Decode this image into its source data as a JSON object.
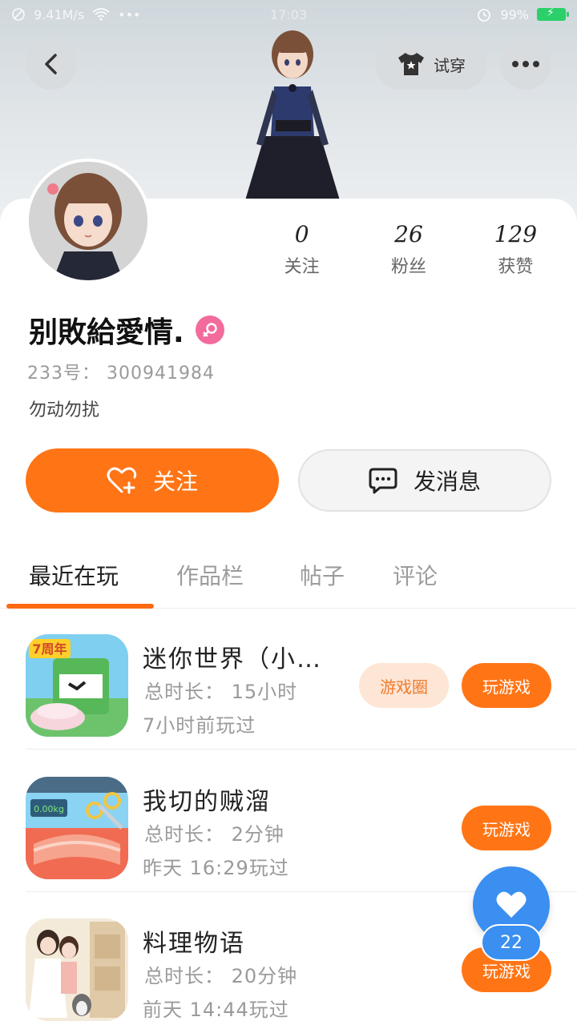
{
  "status_bar": {
    "network_speed": "9.41M/s",
    "time": "17:03",
    "battery": "99%"
  },
  "header": {
    "try_on_label": "试穿"
  },
  "profile": {
    "stats": [
      {
        "value": "0",
        "label": "关注"
      },
      {
        "value": "26",
        "label": "粉丝"
      },
      {
        "value": "129",
        "label": "获赞"
      }
    ],
    "name": "别敗給愛情.",
    "uid": "233号： 300941984",
    "bio": "勿动勿扰",
    "follow_label": "关注",
    "message_label": "发消息"
  },
  "tabs": [
    {
      "label": "最近在玩",
      "active": true
    },
    {
      "label": "作品栏",
      "active": false
    },
    {
      "label": "帖子",
      "active": false
    },
    {
      "label": "评论",
      "active": false
    }
  ],
  "games": [
    {
      "title": "迷你世界（小…",
      "duration": "总时长： 15小时",
      "last_played": "7小时前玩过",
      "circle_label": "游戏圈",
      "play_label": "玩游戏",
      "icon_badge": "7周年"
    },
    {
      "title": "我切的贼溜",
      "duration": "总时长： 2分钟",
      "last_played": "昨天 16:29玩过",
      "play_label": "玩游戏",
      "icon_badge": "0.00kg"
    },
    {
      "title": "料理物语",
      "duration": "总时长： 20分钟",
      "last_played": "前天 14:44玩过",
      "play_label": "玩游戏"
    }
  ],
  "floating_like": {
    "count": "22"
  },
  "colors": {
    "accent": "#ff7516",
    "like_blue": "#3a8ff0",
    "gender_pink": "#f26b9c"
  }
}
